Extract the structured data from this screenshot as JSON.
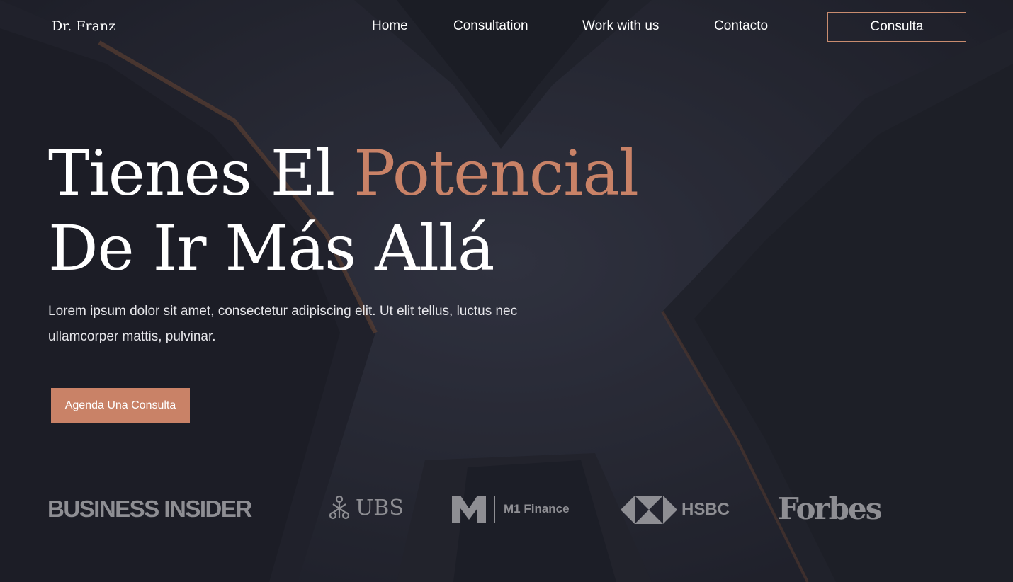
{
  "site": {
    "logo": "Dr. Franz"
  },
  "nav": {
    "items": [
      "Home",
      "Consultation",
      "Work with us",
      "Contacto"
    ],
    "cta": "Consulta"
  },
  "hero": {
    "title_part1": "Tienes El ",
    "title_accent": "Potencial",
    "title_line2": "De Ir Más Allá",
    "subtitle": "Lorem ipsum dolor sit amet, consectetur adipiscing elit. Ut elit tellus, luctus nec ullamcorper mattis, pulvinar.",
    "button": "Agenda Una Consulta"
  },
  "brands": {
    "business_insider": "BUSINESS INSIDER",
    "ubs": "UBS",
    "m1_finance": "M1 Finance",
    "hsbc": "HSBC",
    "forbes": "Forbes"
  },
  "colors": {
    "accent": "#c98267",
    "bg": "#2b2c37",
    "brand_gray": "#8e8e93"
  }
}
